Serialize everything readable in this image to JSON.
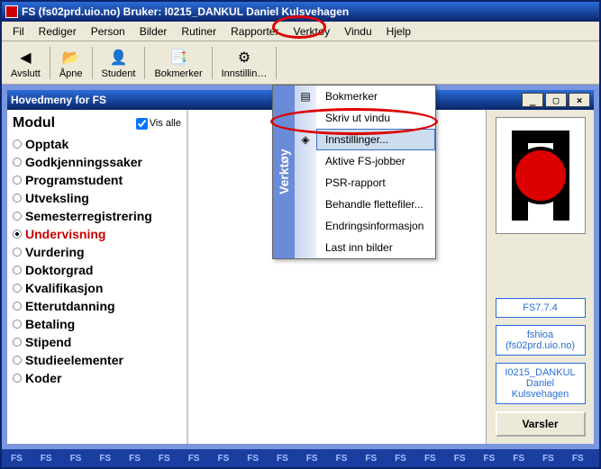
{
  "window": {
    "title": "FS (fs02prd.uio.no) Bruker: I0215_DANKUL Daniel Kulsvehagen"
  },
  "menubar": [
    "Fil",
    "Rediger",
    "Person",
    "Bilder",
    "Rutiner",
    "Rapporter",
    "Verktøy",
    "Vindu",
    "Hjelp"
  ],
  "toolbar": [
    {
      "icon": "◀",
      "label": "Avslutt"
    },
    {
      "icon": "📂",
      "label": "Åpne"
    },
    {
      "icon": "👤",
      "label": "Student"
    },
    {
      "icon": "📑",
      "label": "Bokmerker"
    },
    {
      "icon": "⚙",
      "label": "Innstillin…"
    }
  ],
  "inner": {
    "title": "Hovedmeny for FS",
    "win_buttons": {
      "min": "_",
      "max": "▢",
      "close": "×"
    }
  },
  "modules": {
    "header": "Modul",
    "vis_alle": "Vis alle",
    "items": [
      "Opptak",
      "Godkjenningssaker",
      "Programstudent",
      "Utveksling",
      "Semesterregistrering",
      "Undervisning",
      "Vurdering",
      "Doktorgrad",
      "Kvalifikasjon",
      "Etterutdanning",
      "Betaling",
      "Stipend",
      "Studieelementer",
      "Koder"
    ],
    "selected_index": 5
  },
  "right": {
    "version": "FS7.7.4",
    "db": "fshioa (fs02prd.uio.no)",
    "user": "I0215_DANKUL Daniel Kulsvehagen",
    "varsler": "Varsler"
  },
  "dropdown": {
    "title": "Verktøy",
    "items": [
      {
        "label": "Bokmerker",
        "icon": "▤"
      },
      {
        "label": "Skriv ut vindu",
        "icon": ""
      },
      {
        "label": "Innstillinger...",
        "icon": "◈",
        "highlight": true
      },
      {
        "label": "Aktive FS-jobber",
        "icon": ""
      },
      {
        "label": "PSR-rapport",
        "icon": ""
      },
      {
        "label": "Behandle flettefiler...",
        "icon": ""
      },
      {
        "label": "Endringsinformasjon",
        "icon": ""
      },
      {
        "label": "Last inn bilder",
        "icon": ""
      }
    ]
  },
  "status": "FS"
}
